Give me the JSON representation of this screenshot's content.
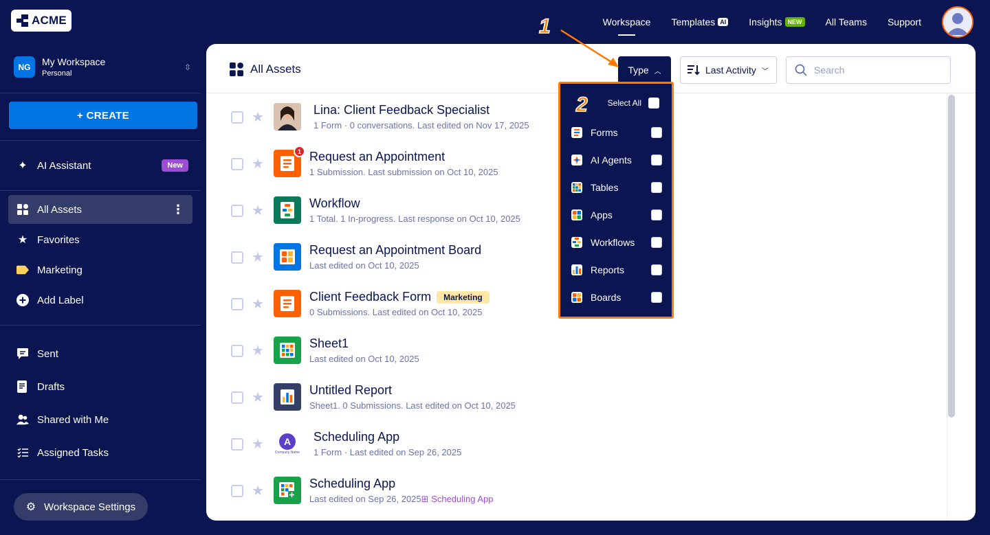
{
  "brand": {
    "name": "ACME"
  },
  "topnav": {
    "items": [
      {
        "label": "Workspace"
      },
      {
        "label": "Templates",
        "badge": "AI"
      },
      {
        "label": "Insights",
        "badge": "NEW"
      },
      {
        "label": "All Teams"
      },
      {
        "label": "Support"
      }
    ]
  },
  "sidebar": {
    "workspace": {
      "initials": "NG",
      "name": "My Workspace",
      "sub": "Personal"
    },
    "create_label": "+ CREATE",
    "ai_assistant": {
      "label": "AI Assistant",
      "badge": "New"
    },
    "nav": [
      {
        "label": "All Assets"
      },
      {
        "label": "Favorites"
      },
      {
        "label": "Marketing"
      },
      {
        "label": "Add Label"
      }
    ],
    "secondary": [
      {
        "label": "Sent"
      },
      {
        "label": "Drafts"
      },
      {
        "label": "Shared with Me"
      },
      {
        "label": "Assigned Tasks"
      }
    ],
    "settings_label": "Workspace Settings"
  },
  "main": {
    "title": "All Assets",
    "type_button": "Type",
    "sort_label": "Last Activity",
    "search_placeholder": "Search",
    "rows": [
      {
        "title": "Lina: Client Feedback Specialist",
        "sub": "1 Form · 0 conversations. Last edited on Nov 17, 2025"
      },
      {
        "title": "Request an Appointment",
        "sub": "1 Submission. Last submission on Oct 10, 2025",
        "badge": "1"
      },
      {
        "title": "Workflow",
        "sub": "1 Total. 1 In-progress. Last response on Oct 10, 2025"
      },
      {
        "title": "Request an Appointment Board",
        "sub": "Last edited on Oct 10, 2025"
      },
      {
        "title": "Client Feedback Form",
        "sub": "0 Submissions. Last edited on Oct 10, 2025",
        "tag": "Marketing"
      },
      {
        "title": "Sheet1",
        "sub": "Last edited on Oct 10, 2025"
      },
      {
        "title": "Untitled Report",
        "sub": "Sheet1. 0 Submissions. Last edited on Oct 10, 2025"
      },
      {
        "title": "Scheduling App",
        "sub": "1 Form · Last edited on Sep 26, 2025",
        "logo_text": "Company Name"
      },
      {
        "title": "Scheduling App",
        "sub": "Last edited on Sep 26, 2025",
        "link": "Scheduling App"
      }
    ]
  },
  "type_dropdown": {
    "select_all": "Select All",
    "options": [
      {
        "label": "Forms"
      },
      {
        "label": "AI Agents"
      },
      {
        "label": "Tables"
      },
      {
        "label": "Apps"
      },
      {
        "label": "Workflows"
      },
      {
        "label": "Reports"
      },
      {
        "label": "Boards"
      }
    ]
  },
  "callouts": {
    "one": "1",
    "two": "2"
  },
  "colors": {
    "navy": "#0a1551",
    "accent": "#ff7a00",
    "blue": "#0075e3",
    "form_orange": "#ff6100",
    "green": "#18a34a"
  }
}
